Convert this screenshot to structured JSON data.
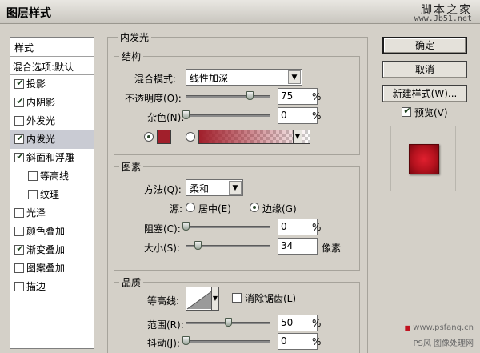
{
  "window": {
    "title": "图层样式",
    "watermark_site": "脚本之家",
    "watermark_url": "www.Jb51.net"
  },
  "style_list": {
    "header": "样式",
    "blend_options": "混合选项:默认",
    "items": [
      {
        "label": "投影",
        "checked": true,
        "sub": false,
        "selected": false
      },
      {
        "label": "内阴影",
        "checked": true,
        "sub": false,
        "selected": false
      },
      {
        "label": "外发光",
        "checked": false,
        "sub": false,
        "selected": false
      },
      {
        "label": "内发光",
        "checked": true,
        "sub": false,
        "selected": true
      },
      {
        "label": "斜面和浮雕",
        "checked": true,
        "sub": false,
        "selected": false
      },
      {
        "label": "等高线",
        "checked": false,
        "sub": true,
        "selected": false
      },
      {
        "label": "纹理",
        "checked": false,
        "sub": true,
        "selected": false
      },
      {
        "label": "光泽",
        "checked": false,
        "sub": false,
        "selected": false
      },
      {
        "label": "颜色叠加",
        "checked": false,
        "sub": false,
        "selected": false
      },
      {
        "label": "渐变叠加",
        "checked": true,
        "sub": false,
        "selected": false
      },
      {
        "label": "图案叠加",
        "checked": false,
        "sub": false,
        "selected": false
      },
      {
        "label": "描边",
        "checked": false,
        "sub": false,
        "selected": false
      }
    ]
  },
  "inner_glow": {
    "title": "内发光",
    "structure": {
      "title": "结构",
      "blend_mode_label": "混合模式:",
      "blend_mode_value": "线性加深",
      "opacity_label": "不透明度(O):",
      "opacity_value": "75",
      "noise_label": "杂色(N):",
      "noise_value": "0",
      "percent": "%",
      "opacity_fraction": 0.75,
      "noise_fraction": 0.0,
      "color_mode": "solid",
      "glow_color": "#a11f2b"
    },
    "elements": {
      "title": "图素",
      "method_label": "方法(Q):",
      "method_value": "柔和",
      "source_label": "源:",
      "source_center": "居中(E)",
      "source_edge": "边缘(G)",
      "source_selected": "edge",
      "choke_label": "阻塞(C):",
      "choke_value": "0",
      "size_label": "大小(S):",
      "size_value": "34",
      "size_unit": "像素",
      "percent": "%",
      "choke_fraction": 0.0,
      "size_fraction": 0.14
    },
    "quality": {
      "title": "品质",
      "contour_label": "等高线:",
      "antialias_label": "消除锯齿(L)",
      "antialias_checked": false,
      "range_label": "范围(R):",
      "range_value": "50",
      "jitter_label": "抖动(J):",
      "jitter_value": "0",
      "percent": "%",
      "range_fraction": 0.5,
      "jitter_fraction": 0.0
    }
  },
  "buttons": {
    "ok": "确定",
    "cancel": "取消",
    "new_style": "新建样式(W)...",
    "preview_label": "预览(V)",
    "preview_checked": true
  },
  "watermark_bottom": {
    "url": "www.psfang.cn",
    "text": "PS风 图像处理网"
  }
}
